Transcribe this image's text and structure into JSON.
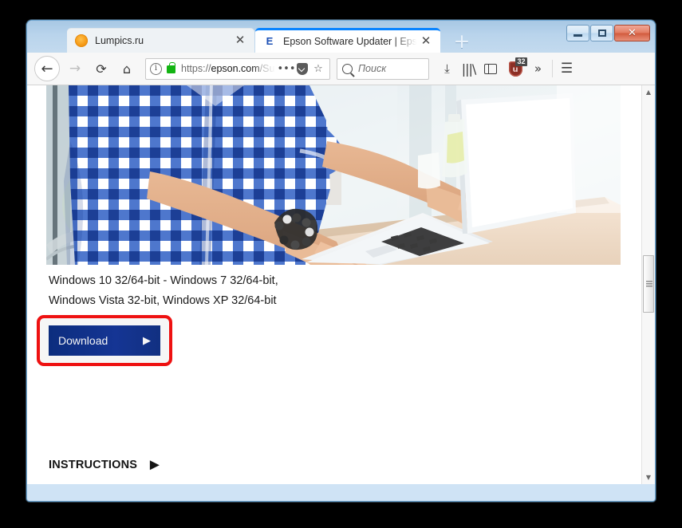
{
  "window": {
    "controls": {
      "minimize_label": "Minimize",
      "maximize_label": "Maximize",
      "close_label": "✕"
    }
  },
  "tabs": [
    {
      "title": "Lumpics.ru",
      "favicon": "orange-circle-icon",
      "close_label": "✕",
      "active": false
    },
    {
      "title": "Epson Software Updater | Epson",
      "favicon": "epson-e-icon",
      "favicon_letter": "E",
      "close_label": "✕",
      "active": true
    }
  ],
  "new_tab": {
    "label": "+"
  },
  "toolbar": {
    "back_label": "←",
    "forward_label": "→",
    "reload_label": "⟳",
    "home_label": "⌂",
    "identity_label": "i",
    "url_protocol": "https://",
    "url_host": "epson.com",
    "url_path": "/Su",
    "page_actions_label": "•••",
    "bookmark_label": "☆",
    "downloads_label": "⤓",
    "library_label": "|||\\",
    "ublock_letter": "u",
    "ublock_badge": "32",
    "overflow_label": "»",
    "menu_label": "☰"
  },
  "search": {
    "placeholder": "Поиск"
  },
  "page": {
    "hero_alt": "Man in blue checkered shirt typing on a white laptop",
    "os_support_line1": "Windows 10 32/64-bit - Windows 7 32/64-bit,",
    "os_support_line2": "Windows Vista 32-bit, Windows XP 32/64-bit",
    "download_label": "Download",
    "download_arrow": "▶",
    "instructions_label": "INSTRUCTIONS",
    "instructions_arrow": "▶"
  },
  "scrollbar": {
    "up_label": "▲",
    "down_label": "▼"
  },
  "colors": {
    "accent_blue": "#16379a",
    "annotation_red": "#ee1111",
    "secure_green": "#13b413",
    "active_tab_indicator": "#0a84ff",
    "ublock_red": "#8c2f25"
  }
}
